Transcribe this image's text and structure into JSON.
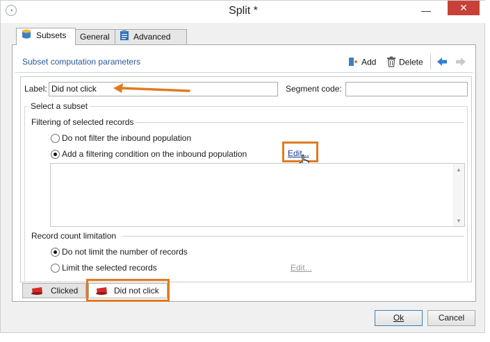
{
  "window": {
    "title": "Split *",
    "minimize_glyph": "—",
    "close_glyph": "✕",
    "app_icon": "adobe-campaign-icon"
  },
  "tabs": [
    {
      "label": "Subsets",
      "icon": "subsets-icon",
      "active": true
    },
    {
      "label": "General",
      "icon": "",
      "active": false
    },
    {
      "label": "Advanced",
      "icon": "clipboard-icon",
      "active": false
    }
  ],
  "toolbar": {
    "title": "Subset computation parameters",
    "add_label": "Add",
    "delete_label": "Delete"
  },
  "form": {
    "label_caption": "Label:",
    "label_value": "Did not click",
    "segment_caption": "Segment code:",
    "segment_value": "",
    "select_subset_legend": "Select a subset",
    "filtering_heading": "Filtering of selected records",
    "filter_options": [
      {
        "label": "Do not filter the inbound population",
        "selected": false
      },
      {
        "label": "Add a filtering condition on the inbound population",
        "selected": true
      }
    ],
    "filter_edit_link": "Edit...",
    "condition_text": "",
    "count_heading": "Record count limitation",
    "count_options": [
      {
        "label": "Do not limit the number of records",
        "selected": true
      },
      {
        "label": "Limit the selected records",
        "selected": false
      }
    ],
    "count_edit_link": "Edit..."
  },
  "subset_tabs": [
    {
      "label": "Clicked",
      "active": false
    },
    {
      "label": "Did not click",
      "active": true
    }
  ],
  "buttons": {
    "ok_label": "Ok",
    "cancel_label": "Cancel"
  },
  "annotation_color": "#e07b20"
}
